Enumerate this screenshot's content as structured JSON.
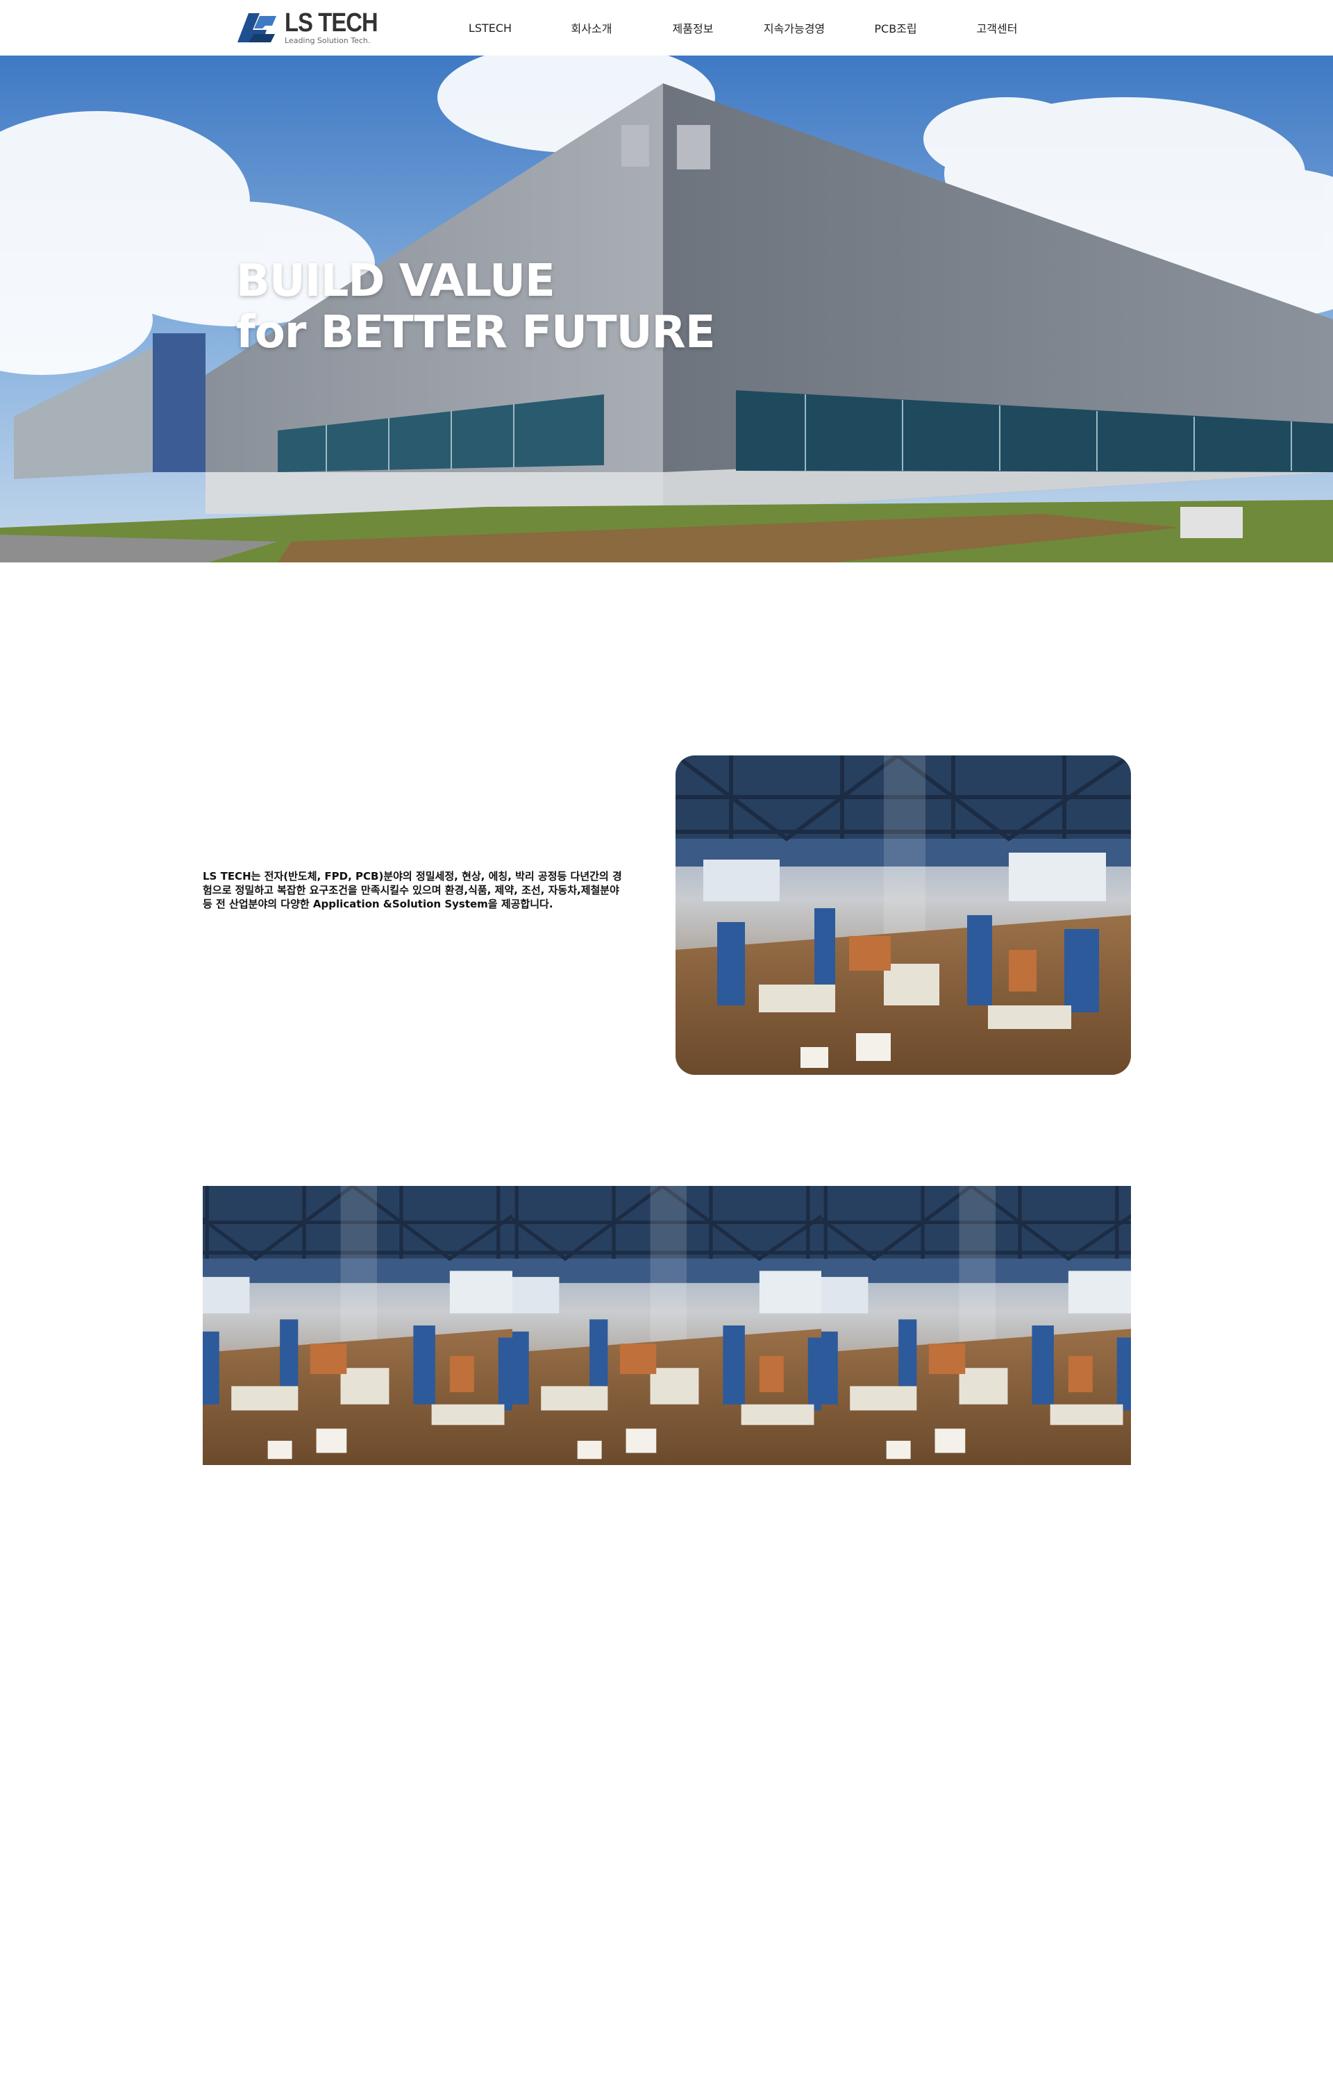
{
  "brand": {
    "name": "LS TECH",
    "tagline": "Leading Solution Tech.",
    "accent": "#1e4f8f"
  },
  "nav": {
    "items": [
      {
        "label": "LSTECH"
      },
      {
        "label": "회사소개"
      },
      {
        "label": "제품정보"
      },
      {
        "label": "지속가능경영"
      },
      {
        "label": "PCB조립"
      },
      {
        "label": "고객센터"
      }
    ]
  },
  "hero": {
    "line1": "BUILD VALUE",
    "line2": "for BETTER FUTURE"
  },
  "intro": {
    "text": "LS TECH는 전자(반도체, FPD, PCB)분야의 정밀세정, 현상, 에칭, 박리 공정등 다년간의 경험으로 정밀하고 복잡한 요구조건을 만족시킬수 있으며 환경,식품, 제약, 조선, 자동차,제철분야 등 전 산업분야의 다양한 Application &Solution System을 제공합니다."
  }
}
